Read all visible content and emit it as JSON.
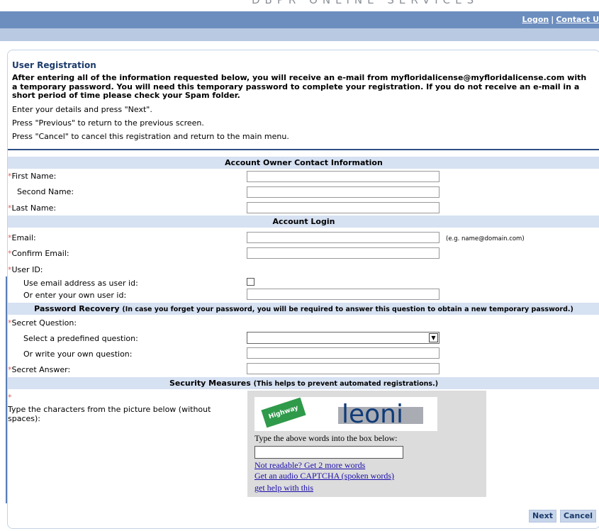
{
  "header": {
    "banner_text": "DBPR ONLINE SERVICES",
    "logon": "Logon",
    "separator": "|",
    "contact": "Contact U"
  },
  "intro": {
    "title": "User Registration",
    "notice": "After entering all of the information requested below, you will receive an e-mail from myfloridalicense@myfloridalicense.com with a temporary password. You will need this temporary password to complete your registration. If you do not receive an e-mail in a short period of time please check your Spam folder.",
    "line1": "Enter your details and press \"Next\".",
    "line2": "Press \"Previous\" to return to the previous screen.",
    "line3": "Press \"Cancel\" to cancel this registration and return to the main menu."
  },
  "required_marker": "*",
  "contact": {
    "header": "Account Owner Contact Information",
    "first_name": "First Name:",
    "second_name": "Second Name:",
    "last_name": "Last Name:"
  },
  "login": {
    "header": "Account Login",
    "email": "Email:",
    "email_hint": "(e.g. name@domain.com)",
    "confirm_email": "Confirm Email:",
    "user_id": "User ID:",
    "use_email": "Use email address as user id:",
    "own_id": "Or enter your own user id:"
  },
  "recovery": {
    "header": "Password Recovery",
    "header_note": "(In case you forget your password, you will be required to answer this question to obtain a new temporary password.)",
    "secret_question": "Secret Question:",
    "predefined": "Select a predefined question:",
    "own_question": "Or write your own question:",
    "secret_answer": "Secret Answer:",
    "selected_question": ""
  },
  "security": {
    "header": "Security Measures",
    "header_note": "(This helps to prevent automated registrations.)",
    "instruction": "Type the characters from the picture below (without spaces):",
    "captcha_word1": "Highway",
    "captcha_word2": "leoni",
    "type_above": "Type the above words into the box below:",
    "link_more": "Not readable? Get 2 more words",
    "link_audio": "Get an audio CAPTCHA (spoken words)",
    "link_help": "get help with this"
  },
  "buttons": {
    "next": "Next",
    "cancel": "Cancel"
  }
}
